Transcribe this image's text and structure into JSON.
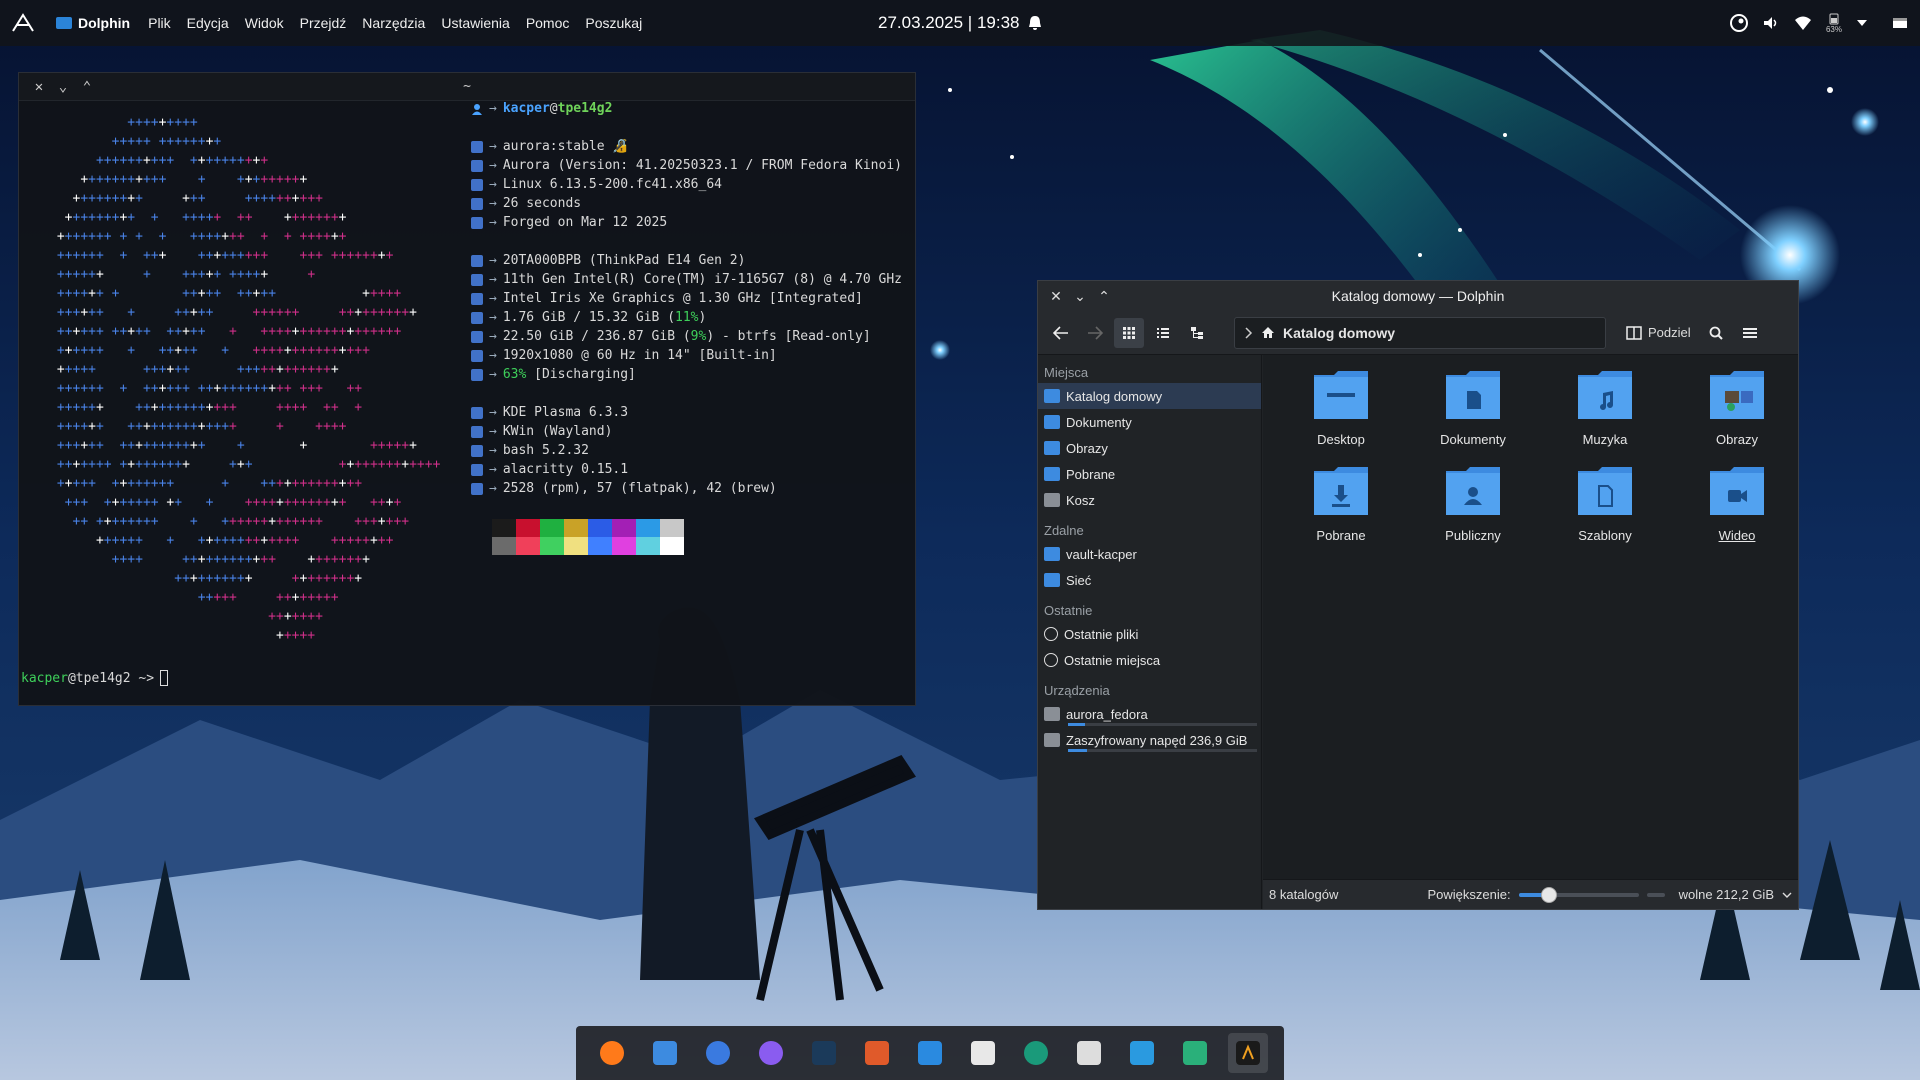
{
  "top_panel": {
    "app_name": "Dolphin",
    "menu": [
      "Plik",
      "Edycja",
      "Widok",
      "Przejdź",
      "Narzędzia",
      "Ustawienia",
      "Pomoc",
      "Poszukaj"
    ],
    "clock": "27.03.2025 | 19:38",
    "battery_percent_label": "63%"
  },
  "terminal": {
    "title": "~",
    "user": "kacper",
    "at": "@",
    "host": "tpe14g2",
    "info": [
      {
        "icon": "image-icon",
        "text": "aurora:stable 🔏"
      },
      {
        "icon": "globe-icon",
        "text": "Aurora (Version: 41.20250323.1 / FROM Fedora Kinoi)"
      },
      {
        "icon": "penguin-icon",
        "text": "Linux 6.13.5-200.fc41.x86_64"
      },
      {
        "icon": "clock-icon",
        "text": "26 seconds"
      },
      {
        "icon": "calendar-icon",
        "text": "Forged on Mar 12 2025"
      },
      {
        "icon": "laptop-icon",
        "text": "20TA000BPB (ThinkPad E14 Gen 2)"
      },
      {
        "icon": "cpu-icon",
        "text": "11th Gen Intel(R) Core(TM) i7-1165G7 (8) @ 4.70 GHz"
      },
      {
        "icon": "gpu-icon",
        "text": "Intel Iris Xe Graphics @ 1.30 GHz [Integrated]"
      },
      {
        "icon": "memory-icon",
        "pre": "1.76 GiB / 15.32 GiB (",
        "hl": "11%",
        "post": ")"
      },
      {
        "icon": "disk-icon",
        "pre": "22.50 GiB / 236.87 GiB (",
        "hl": "9%",
        "post": ") - btrfs [Read-only]"
      },
      {
        "icon": "monitor-icon",
        "text": "1920x1080 @ 60 Hz in 14\" [Built-in]"
      },
      {
        "icon": "battery-icon",
        "pre": "",
        "hl": "63%",
        "post": " [Discharging]"
      },
      {
        "icon": "desktop-env-icon",
        "text": "KDE Plasma 6.3.3"
      },
      {
        "icon": "window-manager-icon",
        "text": "KWin (Wayland)"
      },
      {
        "icon": "shell-icon",
        "text": "bash 5.2.32"
      },
      {
        "icon": "terminal-app-icon",
        "text": "alacritty 0.15.1"
      },
      {
        "icon": "package-icon",
        "text": "2528 (rpm), 57 (flatpak), 42 (brew)"
      }
    ],
    "arrow": "→",
    "palette_top": [
      "#1b1b1b",
      "#c8102e",
      "#1fb040",
      "#c9a227",
      "#2b5ce6",
      "#a31fb5",
      "#2b9ae6",
      "#c8c8c8"
    ],
    "palette_bottom": [
      "#6b6b6b",
      "#f0405a",
      "#40d060",
      "#f0e080",
      "#4080ff",
      "#e040e0",
      "#60d0e0",
      "#ffffff"
    ],
    "prompt_user": "kacper",
    "prompt_host": "@tpe14g2",
    "prompt_symbol": "~>"
  },
  "dolphin": {
    "title": "Katalog domowy — Dolphin",
    "location": "Katalog domowy",
    "split_label": "Podziel",
    "sections": {
      "places": "Miejsca",
      "remote": "Zdalne",
      "recent": "Ostatnie",
      "devices": "Urządzenia"
    },
    "places": [
      "Katalog domowy",
      "Dokumenty",
      "Obrazy",
      "Pobrane",
      "Kosz"
    ],
    "remote": [
      "vault-kacper",
      "Sieć"
    ],
    "recent": [
      "Ostatnie pliki",
      "Ostatnie miejsca"
    ],
    "devices": [
      {
        "label": "aurora_fedora",
        "usage": 0.09
      },
      {
        "label": "Zaszyfrowany napęd 236,9 GiB",
        "usage": 0.1
      }
    ],
    "folders": [
      {
        "label": "Desktop",
        "icon": "desktop-folder-icon"
      },
      {
        "label": "Dokumenty",
        "icon": "documents-folder-icon"
      },
      {
        "label": "Muzyka",
        "icon": "music-folder-icon"
      },
      {
        "label": "Obrazy",
        "icon": "pictures-folder-icon"
      },
      {
        "label": "Pobrane",
        "icon": "downloads-folder-icon"
      },
      {
        "label": "Publiczny",
        "icon": "public-folder-icon"
      },
      {
        "label": "Szablony",
        "icon": "templates-folder-icon"
      },
      {
        "label": "Wideo",
        "icon": "videos-folder-icon"
      }
    ],
    "status": {
      "count": "8 katalogów",
      "zoom_label": "Powiększenie:",
      "zoom_level": 0.25,
      "free": "wolne 212,2 GiB"
    },
    "accent": "#3d8be0"
  },
  "dock": {
    "apps": [
      "firefox-icon",
      "dolphin-icon",
      "thunderbird-icon",
      "messenger-icon",
      "steam-icon",
      "app-store-icon",
      "vscode-icon",
      "text-editor-icon",
      "settings-circle-icon",
      "kde-connect-icon",
      "package-installer-icon",
      "tweaks-icon",
      "terminal-icon"
    ],
    "active": "terminal-icon"
  }
}
